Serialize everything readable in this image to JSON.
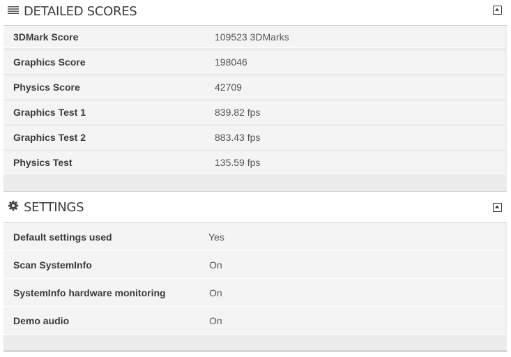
{
  "detailed_scores": {
    "title": "DETAILED SCORES",
    "icon": "list-icon",
    "collapse_icon": "collapse-up-icon",
    "rows": [
      {
        "label": "3DMark Score",
        "value": "109523 3DMarks"
      },
      {
        "label": "Graphics Score",
        "value": "198046"
      },
      {
        "label": "Physics Score",
        "value": "42709"
      },
      {
        "label": "Graphics Test 1",
        "value": "839.82 fps"
      },
      {
        "label": "Graphics Test 2",
        "value": "883.43 fps"
      },
      {
        "label": "Physics Test",
        "value": "135.59 fps"
      }
    ]
  },
  "settings": {
    "title": "SETTINGS",
    "icon": "gear-icon",
    "collapse_icon": "collapse-up-icon",
    "rows": [
      {
        "label": "Default settings used",
        "value": "Yes"
      },
      {
        "label": "Scan SystemInfo",
        "value": "On"
      },
      {
        "label": "SystemInfo hardware monitoring",
        "value": "On"
      },
      {
        "label": "Demo audio",
        "value": "On"
      }
    ]
  }
}
